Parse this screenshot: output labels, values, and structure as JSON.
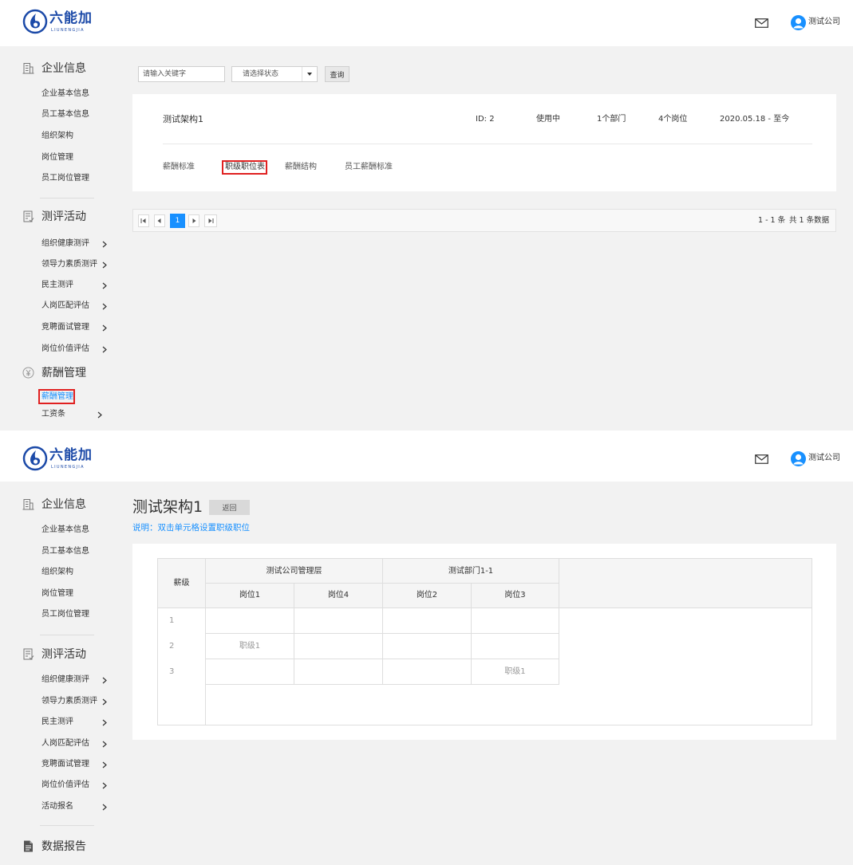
{
  "brand": {
    "name": "六能加",
    "subtitle": "LIUNENGJIA"
  },
  "user": {
    "name": "测试公司"
  },
  "colors": {
    "accent": "#1890ff",
    "highlight_box": "#e02020",
    "brand": "#1c4aa8"
  },
  "icons": {
    "logo": "brand-logo-icon",
    "mail": "mail-icon",
    "avatar": "user-avatar-icon",
    "enterprise": "building-icon",
    "evaluation": "clipboard-icon",
    "salary": "yen-icon",
    "reports": "document-icon",
    "submenu": "chevron-right-icon"
  },
  "top": {
    "sidebar": {
      "enterprise": {
        "title": "企业信息",
        "items": [
          "企业基本信息",
          "员工基本信息",
          "组织架构",
          "岗位管理",
          "员工岗位管理"
        ]
      },
      "evaluation": {
        "title": "测评活动",
        "items": [
          "组织健康测评",
          "领导力素质测评",
          "民主测评",
          "人岗匹配评估",
          "竞聘面试管理",
          "岗位价值评估"
        ]
      },
      "salary": {
        "title": "薪酬管理",
        "items": [
          {
            "label": "薪酬管理",
            "active": true
          },
          {
            "label": "工资条",
            "active": false
          }
        ]
      }
    },
    "filters": {
      "keyword_placeholder": "请输入关键字",
      "status_placeholder": "请选择状态",
      "search_label": "查询"
    },
    "structure": {
      "name": "测试架构1",
      "id": "ID: 2",
      "status": "使用中",
      "departments": "1个部门",
      "positions": "4个岗位",
      "period": "2020.05.18 - 至今",
      "tabs": [
        {
          "label": "薪酬标准",
          "selected": false
        },
        {
          "label": "职级职位表",
          "selected": true
        },
        {
          "label": "薪酬结构",
          "selected": false
        },
        {
          "label": "员工薪酬标准",
          "selected": false
        }
      ]
    },
    "pagination": {
      "current_page": "1",
      "range": "1 - 1 条",
      "total": "共 1 条数据"
    }
  },
  "bottom": {
    "sidebar": {
      "enterprise": {
        "title": "企业信息",
        "items": [
          "企业基本信息",
          "员工基本信息",
          "组织架构",
          "岗位管理",
          "员工岗位管理"
        ]
      },
      "evaluation": {
        "title": "测评活动",
        "items": [
          "组织健康测评",
          "领导力素质测评",
          "民主测评",
          "人岗匹配评估",
          "竞聘面试管理",
          "岗位价值评估",
          "活动报名"
        ]
      },
      "reports": {
        "title": "数据报告"
      }
    },
    "page": {
      "title": "测试架构1",
      "back_label": "返回",
      "hint": "说明：双击单元格设置职级职位"
    },
    "grade_table": {
      "level_header": "薪级",
      "departments": [
        {
          "name": "测试公司管理层",
          "positions": [
            "岗位1",
            "岗位4"
          ]
        },
        {
          "name": "测试部门1-1",
          "positions": [
            "岗位2",
            "岗位3"
          ]
        }
      ],
      "rows": [
        {
          "level": "1",
          "cells": [
            "",
            "",
            "",
            ""
          ]
        },
        {
          "level": "2",
          "cells": [
            "职级1",
            "",
            "",
            ""
          ]
        },
        {
          "level": "3",
          "cells": [
            "",
            "",
            "",
            "职级1"
          ]
        }
      ]
    }
  }
}
